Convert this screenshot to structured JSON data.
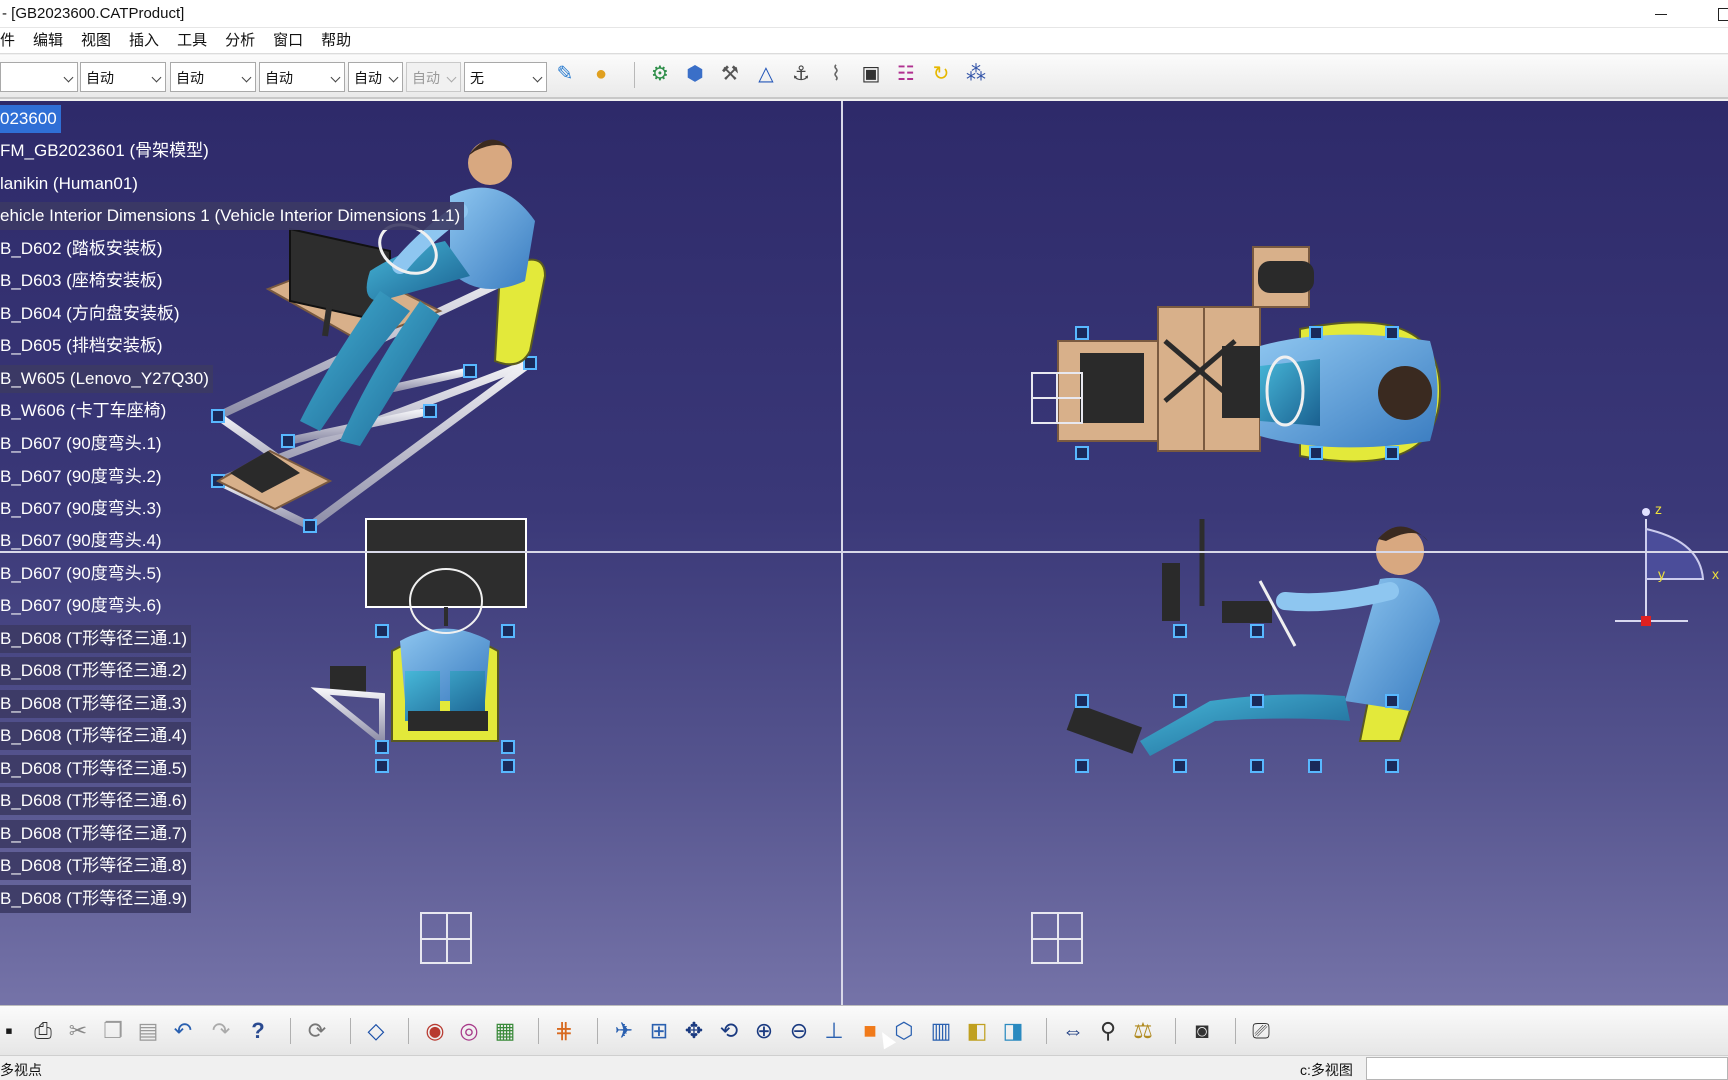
{
  "window": {
    "title": "- [GB2023600.CATProduct]"
  },
  "menu": [
    "文件",
    "编辑",
    "视图",
    "插入",
    "工具",
    "分析",
    "窗口",
    "帮助"
  ],
  "menu_visible": [
    "件",
    "编辑",
    "视图",
    "插入",
    "工具",
    "分析",
    "窗口",
    "帮助"
  ],
  "toolbar_top": {
    "dropdowns": [
      {
        "value": ""
      },
      {
        "value": "自动"
      },
      {
        "value": "自动"
      },
      {
        "value": "自动"
      },
      {
        "value": "自动"
      },
      {
        "value": "自动",
        "disabled": true
      },
      {
        "value": "无"
      }
    ],
    "icons": [
      "painter-brush-icon",
      "apply-material-icon",
      "parts-manage-icon",
      "component-icon",
      "bolt-icon",
      "constraint-anchor-icon",
      "fix-icon",
      "clip-icon",
      "measure-box-icon",
      "cables-icon",
      "update-icon",
      "settings-grid-icon"
    ]
  },
  "tree": {
    "items": [
      {
        "label": "023600",
        "selected": true
      },
      {
        "label": "FM_GB2023601 (骨架模型)"
      },
      {
        "label": "lanikin (Human01)"
      },
      {
        "label": "ehicle Interior Dimensions 1 (Vehicle Interior Dimensions 1.1)"
      },
      {
        "label": "B_D602 (踏板安装板)"
      },
      {
        "label": "B_D603 (座椅安装板)"
      },
      {
        "label": "B_D604 (方向盘安装板)"
      },
      {
        "label": "B_D605 (排档安装板)"
      },
      {
        "label": "B_W605 (Lenovo_Y27Q30)"
      },
      {
        "label": "B_W606 (卡丁车座椅)"
      },
      {
        "label": "B_D607 (90度弯头.1)"
      },
      {
        "label": "B_D607 (90度弯头.2)"
      },
      {
        "label": "B_D607 (90度弯头.3)"
      },
      {
        "label": "B_D607 (90度弯头.4)"
      },
      {
        "label": "B_D607 (90度弯头.5)"
      },
      {
        "label": "B_D607 (90度弯头.6)"
      },
      {
        "label": "B_D608 (T形等径三通.1)"
      },
      {
        "label": "B_D608 (T形等径三通.2)"
      },
      {
        "label": "B_D608 (T形等径三通.3)"
      },
      {
        "label": "B_D608 (T形等径三通.4)"
      },
      {
        "label": "B_D608 (T形等径三通.5)"
      },
      {
        "label": "B_D608 (T形等径三通.6)"
      },
      {
        "label": "B_D608 (T形等径三通.7)"
      },
      {
        "label": "B_D608 (T形等径三通.8)"
      },
      {
        "label": "B_D608 (T形等径三通.9)"
      }
    ]
  },
  "compass": {
    "x_label": "x",
    "y_label": "y",
    "z_label": "z"
  },
  "toolbar_bottom": {
    "icons": [
      "save-icon",
      "print-icon",
      "cut-icon",
      "copy-icon",
      "paste-icon",
      "undo-icon",
      "redo-icon",
      "whats-this-icon",
      "refresh-icon",
      "eraser-icon",
      "sphere-render-icon",
      "material-icon",
      "color-cube-icon",
      "grid-snap-icon",
      "fly-mode-icon",
      "fit-all-icon",
      "pan-icon",
      "rotate-icon",
      "zoom-in-icon",
      "zoom-out-icon",
      "normal-view-icon",
      "multi-view-icon",
      "iso-view-icon",
      "shading-icon",
      "hide-show-icon",
      "swap-space-icon",
      "measure-icon",
      "analysis-icon",
      "weight-icon",
      "capture-icon",
      "scene-icon"
    ]
  },
  "status": {
    "left_text": "多视点",
    "right_text": "c:多视图",
    "command_value": ""
  }
}
